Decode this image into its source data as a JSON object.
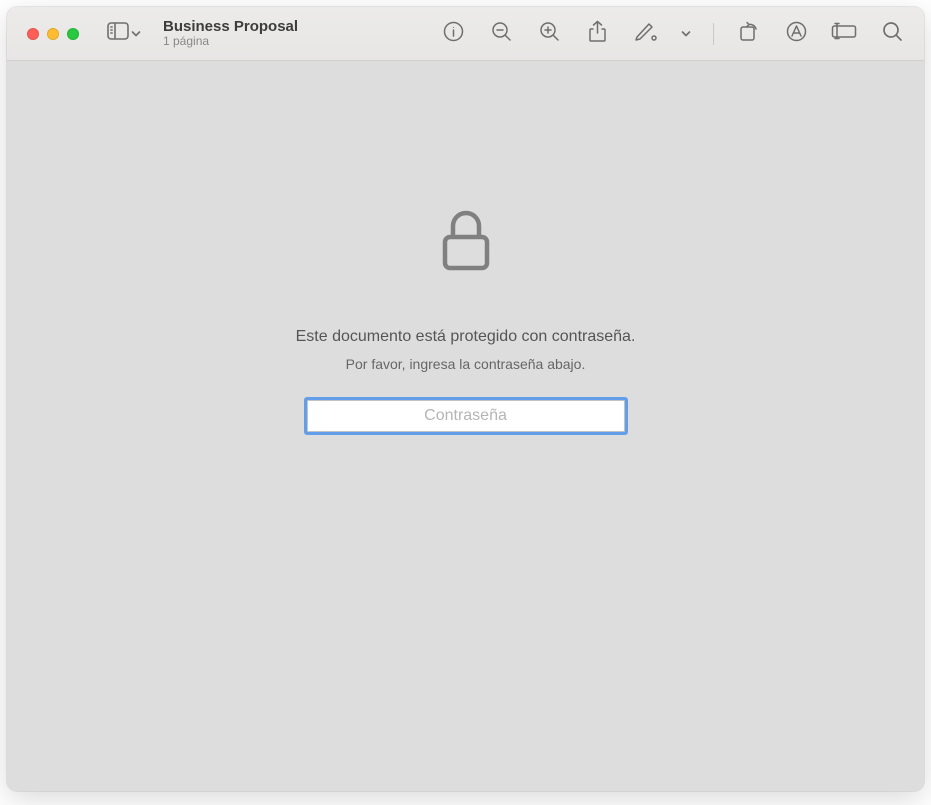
{
  "window": {
    "title": "Business Proposal",
    "subtitle": "1 página"
  },
  "toolbar": {
    "icons": {
      "sidebar": "sidebar-icon",
      "info": "info-icon",
      "zoom_out": "zoom-out-icon",
      "zoom_in": "zoom-in-icon",
      "share": "share-icon",
      "markup": "markup-icon",
      "markup_chevron": "chevron-down-icon",
      "rotate": "rotate-icon",
      "highlight": "highlight-icon",
      "crop": "crop-icon",
      "search": "search-icon"
    }
  },
  "prompt": {
    "protected_message": "Este documento está protegido con contraseña.",
    "enter_message": "Por favor, ingresa la contraseña abajo.",
    "placeholder": "Contraseña"
  }
}
